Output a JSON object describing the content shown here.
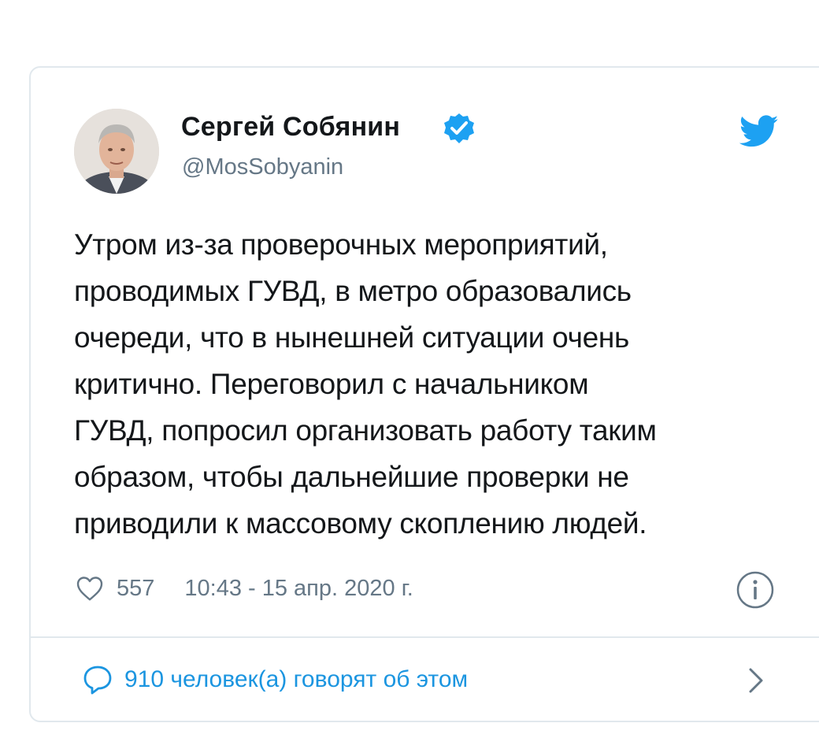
{
  "author": {
    "name": "Сергей Собянин",
    "handle": "@MosSobyanin",
    "verified": true,
    "avatar_icon": "person-photo-avatar"
  },
  "tweet": {
    "text": "Утром из-за проверочных мероприятий,\nпроводимых ГУВД, в метро образовались\nочереди, что в нынешней ситуации очень\nкритично. Переговорил с начальником\nГУВД, попросил организовать работу таким\nобразом, чтобы дальнейшие проверки не\nприводили к массовому скоплению людей.",
    "likes": "557",
    "timestamp": "10:43 - 15 апр. 2020 г."
  },
  "footer": {
    "conversation_label": "910 человек(а) говорят об этом"
  },
  "icons": {
    "verified": "verified-badge-icon",
    "brand": "twitter-bird-icon",
    "like": "heart-icon",
    "info": "info-icon",
    "reply": "comment-icon",
    "more": "chevron-right-icon"
  },
  "colors": {
    "accent": "#1da1f2",
    "link": "#1b95e0",
    "secondary_text": "#657786",
    "border": "#e1e8ed",
    "primary_text": "#14171a"
  }
}
